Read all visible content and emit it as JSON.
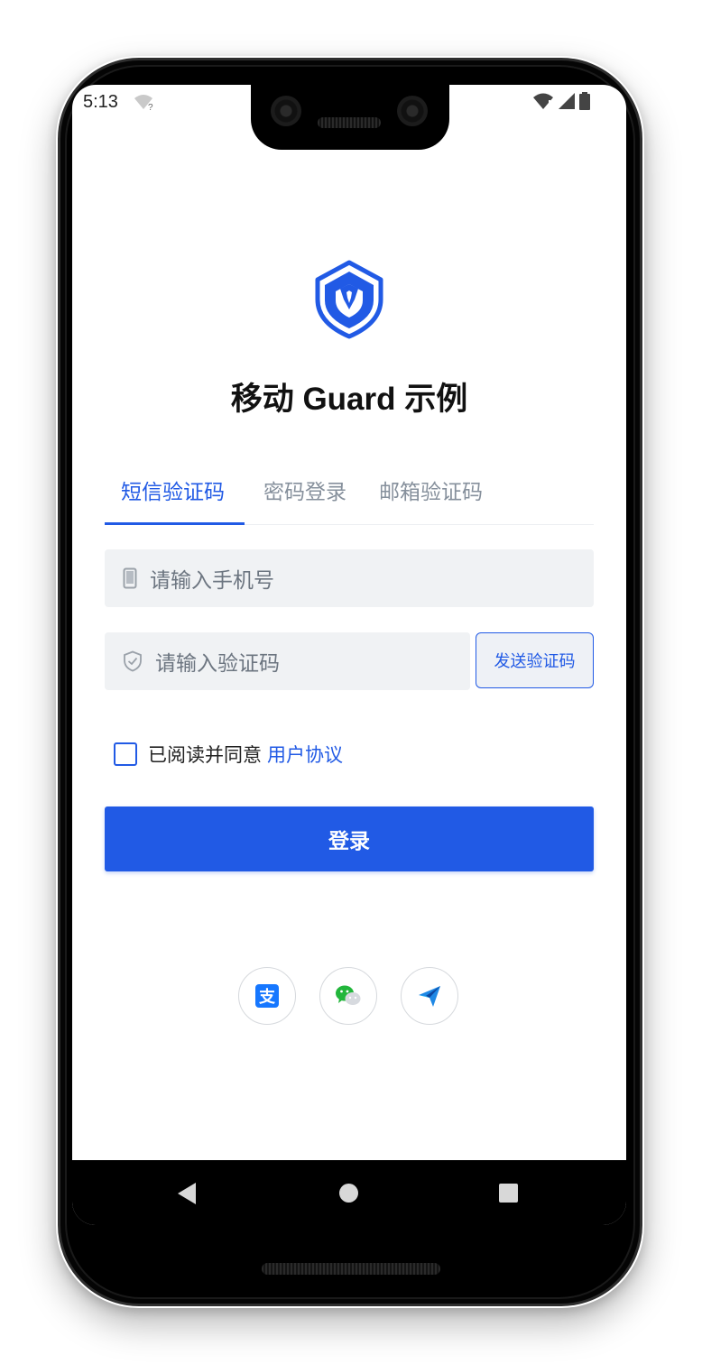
{
  "status_bar": {
    "time": "5:13"
  },
  "app": {
    "title": "移动 Guard 示例",
    "brand_color": "#215AE5"
  },
  "tabs": [
    {
      "label": "短信验证码",
      "active": true
    },
    {
      "label": "密码登录",
      "active": false
    },
    {
      "label": "邮箱验证码",
      "active": false
    }
  ],
  "form": {
    "phone_placeholder": "请输入手机号",
    "code_placeholder": "请输入验证码",
    "send_code_label": "发送验证码",
    "agree_text": "已阅读并同意",
    "agreement_link": "用户协议",
    "agreement_checked": false,
    "login_label": "登录"
  },
  "social_login": [
    {
      "icon": "alipay-icon",
      "glyph": "支"
    },
    {
      "icon": "wechat-icon"
    },
    {
      "icon": "feishu-icon"
    }
  ],
  "nav_bar": {
    "buttons": [
      "back-icon",
      "home-icon",
      "recents-icon"
    ]
  }
}
